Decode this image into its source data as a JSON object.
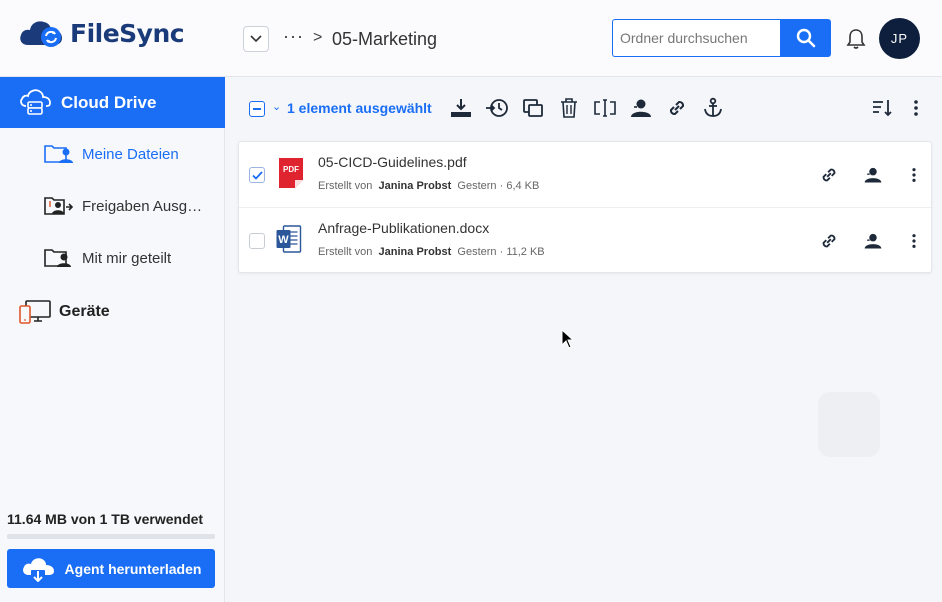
{
  "app": {
    "name": "FileSync"
  },
  "breadcrumb": {
    "ellipsis": "···",
    "separator": ">",
    "current": "05-Marketing"
  },
  "search": {
    "placeholder": "Ordner durchsuchen",
    "value": ""
  },
  "user": {
    "initials": "JP"
  },
  "sidebar": {
    "cloud_drive": "Cloud Drive",
    "items": [
      {
        "label": "Meine Dateien",
        "icon": "folder-user-icon",
        "active": true
      },
      {
        "label": "Freigaben Ausg…",
        "icon": "folder-share-out-icon",
        "active": false
      },
      {
        "label": "Mit mir geteilt",
        "icon": "folder-shared-with-me-icon",
        "active": false
      }
    ],
    "devices": "Geräte",
    "usage": "11.64 MB von 1 TB verwendet",
    "usage_fraction": 1e-05,
    "agent_button": "Agent herunterladen"
  },
  "toolbar": {
    "selection_label": "1 element ausgewählt",
    "tools": [
      "download-icon",
      "restore-icon",
      "copy-icon",
      "trash-icon",
      "rename-icon",
      "share-user-icon",
      "link-icon",
      "anchor-icon"
    ],
    "sort_icon": "sort-icon",
    "more_icon": "more-vertical-icon"
  },
  "files": [
    {
      "name": "05-CICD-Guidelines.pdf",
      "created_by_label": "Erstellt von",
      "author": "Janina Probst",
      "details": "Gestern · 6,4 KB",
      "type": "pdf",
      "icon_text": "PDF",
      "checked": true
    },
    {
      "name": "Anfrage-Publikationen.docx",
      "created_by_label": "Erstellt von",
      "author": "Janina Probst",
      "details": "Gestern · 11,2 KB",
      "type": "docx",
      "icon_text": "W",
      "checked": false
    }
  ],
  "colors": {
    "primary": "#1a6ef5",
    "logo_text": "#1a3a7a",
    "avatar_bg": "#0d1f3c",
    "pdf": "#e0242f",
    "word": "#2b579a"
  }
}
